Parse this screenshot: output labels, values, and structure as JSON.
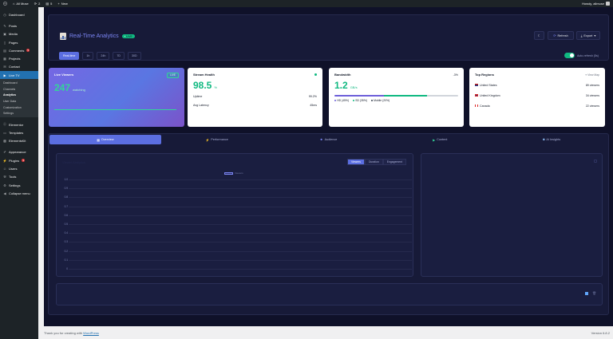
{
  "admin_bar": {
    "site_name": "All Muse",
    "updates": "2",
    "comments": "5",
    "new_label": "New",
    "howdy": "Howdy, allmuse"
  },
  "sidebar": {
    "items": [
      {
        "label": "Dashboard",
        "icon": "dashboard-icon"
      },
      {
        "label": "Posts",
        "icon": "pin-icon"
      },
      {
        "label": "Media",
        "icon": "media-icon"
      },
      {
        "label": "Pages",
        "icon": "page-icon"
      },
      {
        "label": "Comments",
        "icon": "comment-icon",
        "badge": "5"
      },
      {
        "label": "Projects",
        "icon": "portfolio-icon"
      },
      {
        "label": "Contact",
        "icon": "envelope-icon"
      },
      {
        "label": "Live TV",
        "icon": "video-icon"
      }
    ],
    "submenu": [
      "Dashboard",
      "Channels",
      "Analytics",
      "User Data",
      "Customization",
      "Settings"
    ],
    "items2": [
      {
        "label": "Elementor",
        "icon": "elementor-icon"
      },
      {
        "label": "Templates",
        "icon": "folder-icon"
      },
      {
        "label": "ElementsKit",
        "icon": "grid-icon"
      },
      {
        "label": "Appearance",
        "icon": "brush-icon"
      },
      {
        "label": "Plugins",
        "icon": "plug-icon",
        "badge": "3"
      },
      {
        "label": "Users",
        "icon": "user-icon"
      },
      {
        "label": "Tools",
        "icon": "wrench-icon"
      },
      {
        "label": "Settings",
        "icon": "settings-icon"
      },
      {
        "label": "Collapse menu",
        "icon": "collapse-icon"
      }
    ]
  },
  "header": {
    "title": "Real-Time Analytics",
    "live_label": "LIVE",
    "refresh_label": "Refresh",
    "export_label": "Export",
    "ranges": [
      "Real-time",
      "1h",
      "24h",
      "7D",
      "30D"
    ],
    "auto_refresh_label": "Auto-refresh (5s)"
  },
  "cards": {
    "viewers": {
      "title": "Live Viewers",
      "tag": "LIVE",
      "value": "247",
      "unit": "watching"
    },
    "health": {
      "title": "Stream Health",
      "value": "98.5",
      "unit": "%",
      "rows": [
        {
          "k": "Uptime",
          "v": "99.2%"
        },
        {
          "k": "Avg Latency",
          "v": "45ms"
        }
      ]
    },
    "bandwidth": {
      "title": "Bandwidth",
      "change": "-3%",
      "value": "1.2",
      "unit": "GB/s",
      "legend": [
        "HD (45%)",
        "SD (35%)",
        "Mobile (20%)"
      ]
    },
    "regions": {
      "title": "Top Regions",
      "view_map": "View Map",
      "rows": [
        {
          "name": "United States",
          "v": "89 viewers"
        },
        {
          "name": "United Kingdom",
          "v": "34 viewers"
        },
        {
          "name": "Canada",
          "v": "22 viewers"
        }
      ]
    }
  },
  "tabs": [
    "Overview",
    "Performance",
    "Audience",
    "Content",
    "AI Insights"
  ],
  "chart_panel": {
    "title": "Viewer Analytics",
    "segments": [
      "Viewers",
      "Duration",
      "Engagement"
    ],
    "legend_label": "Viewers"
  },
  "chart_data": {
    "type": "line",
    "series": [
      {
        "name": "Viewers",
        "values": []
      }
    ],
    "y_ticks": [
      "1.0",
      "0.9",
      "0.8",
      "0.7",
      "0.6",
      "0.5",
      "0.4",
      "0.3",
      "0.2",
      "0.1",
      "0"
    ],
    "ylim": [
      0,
      1.0
    ],
    "grid": true,
    "legend": "top-center"
  },
  "footer": {
    "thanks": "Thank you for creating with ",
    "link": "WordPress",
    "version": "Version 6.8.2"
  },
  "colors": {
    "accent": "#5b6ee1",
    "success": "#10b981",
    "admin_blue": "#2271b1"
  }
}
